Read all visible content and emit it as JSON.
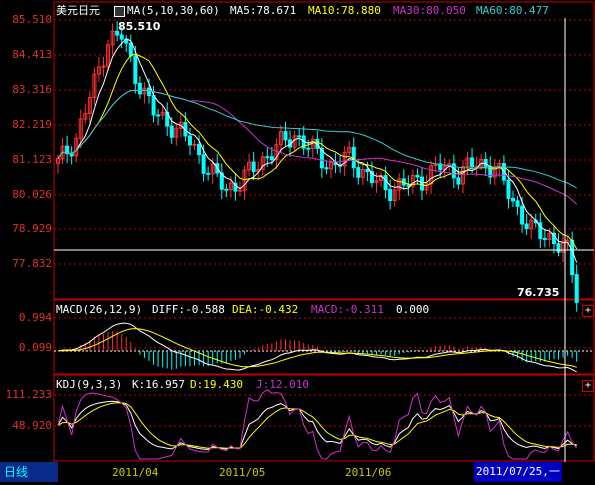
{
  "title": "美元日元",
  "ma_header": {
    "params": "MA(5,10,30,60)",
    "ma5_label": "MA5:78.671",
    "ma10_label": "MA10:78.880",
    "ma30_label": "MA30:80.050",
    "ma60_label": "MA60:80.477"
  },
  "price_axis": [
    "85.510",
    "84.413",
    "83.316",
    "82.219",
    "81.123",
    "80.026",
    "78.929",
    "77.832"
  ],
  "high_label": "85.510",
  "low_label": "76.735",
  "macd_header": {
    "params": "MACD(26,12,9)",
    "diff": "DIFF:-0.588",
    "dea": "DEA:-0.432",
    "macd": "MACD:-0.311",
    "extra": "0.000"
  },
  "macd_axis": [
    "0.994",
    "0.099"
  ],
  "kdj_header": {
    "params": "KDJ(9,3,3)",
    "k": "K:16.957",
    "d": "D:19.430",
    "j": "J:12.010"
  },
  "kdj_axis": [
    "111.233",
    "48.920"
  ],
  "period_tab": "日线",
  "x_labels": [
    "2011/04",
    "2011/05",
    "2011/06"
  ],
  "cursor_date": "2011/07/25,一",
  "colors": {
    "up": "#ff3030",
    "down": "#00ffff",
    "ma5": "#ffffff",
    "ma10": "#ffff00",
    "ma30": "#cc33cc",
    "ma60": "#33cccc",
    "grid": "#c00000"
  },
  "chart_data": [
    {
      "type": "candlestick",
      "title": "美元日元",
      "ylim": [
        76.735,
        85.51
      ],
      "x": [
        "2011/04",
        "2011/05",
        "2011/06",
        "2011/07/25"
      ],
      "series": [
        {
          "name": "MA5",
          "values": [
            83.8,
            81.4,
            80.3,
            78.671
          ]
        },
        {
          "name": "MA10",
          "values": [
            84.1,
            81.5,
            80.4,
            78.88
          ]
        },
        {
          "name": "MA30",
          "values": [
            82.8,
            81.9,
            80.7,
            80.05
          ]
        },
        {
          "name": "MA60",
          "values": [
            82.1,
            82.0,
            81.1,
            80.477
          ]
        }
      ]
    },
    {
      "type": "bar",
      "title": "MACD(26,12,9)",
      "series": [
        {
          "name": "DIFF",
          "values": [
            -0.588
          ]
        },
        {
          "name": "DEA",
          "values": [
            -0.432
          ]
        },
        {
          "name": "MACD",
          "values": [
            -0.311
          ]
        }
      ]
    },
    {
      "type": "line",
      "title": "KDJ(9,3,3)",
      "series": [
        {
          "name": "K",
          "values": [
            16.957
          ]
        },
        {
          "name": "D",
          "values": [
            19.43
          ]
        },
        {
          "name": "J",
          "values": [
            12.01
          ]
        }
      ]
    }
  ]
}
